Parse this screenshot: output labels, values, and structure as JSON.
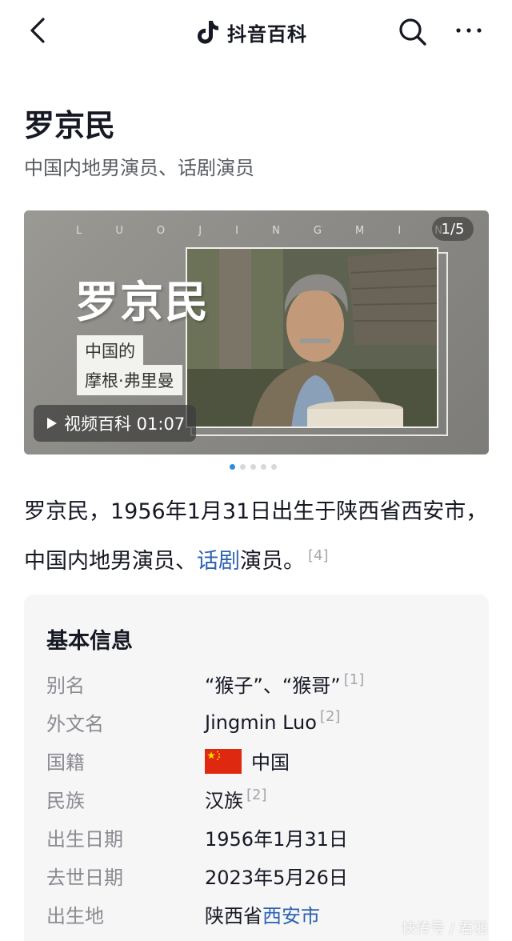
{
  "topbar": {
    "brand": "抖音百科",
    "back_icon": "chevron-left-icon",
    "search_icon": "search-icon",
    "more_icon": "more-horizontal-icon"
  },
  "entry": {
    "title": "罗京民",
    "subtitle": "中国内地男演员、话剧演员"
  },
  "media": {
    "counter": "1/5",
    "letters": [
      "L",
      "U",
      "O",
      "J",
      "I",
      "N",
      "G",
      "M",
      "I",
      "N"
    ],
    "big_name": "罗京民",
    "tag_line1": "中国的",
    "tag_line2": "摩根·弗里曼",
    "video_label": "视频百科 01:07",
    "slides_total": 5,
    "slide_active": 1
  },
  "summary": {
    "part1": "罗京民，1956年1月31日出生于陕西省西安市，中国内地男演员、",
    "link": "话剧",
    "part2": "演员。",
    "ref": "[4]"
  },
  "info": {
    "title": "基本信息",
    "rows": [
      {
        "key": "别名",
        "value": "“猴子”、“猴哥”",
        "ref": "[1]"
      },
      {
        "key": "外文名",
        "value": "Jingmin Luo",
        "ref": "[2]"
      },
      {
        "key": "国籍",
        "value": "中国",
        "ref": ""
      },
      {
        "key": "民族",
        "value": "汉族",
        "ref": "[2]"
      },
      {
        "key": "出生日期",
        "value": "1956年1月31日",
        "ref": ""
      },
      {
        "key": "去世日期",
        "value": "2023年5月26日",
        "ref": ""
      },
      {
        "key": "出生地",
        "value_prefix": "陕西省",
        "value_link": "西安市",
        "ref": ""
      }
    ]
  },
  "watermark": "快传号 / 君羽",
  "colors": {
    "link": "#2c62b0",
    "dot_active": "#2b8de0",
    "card_bg": "#f6f6f7"
  }
}
